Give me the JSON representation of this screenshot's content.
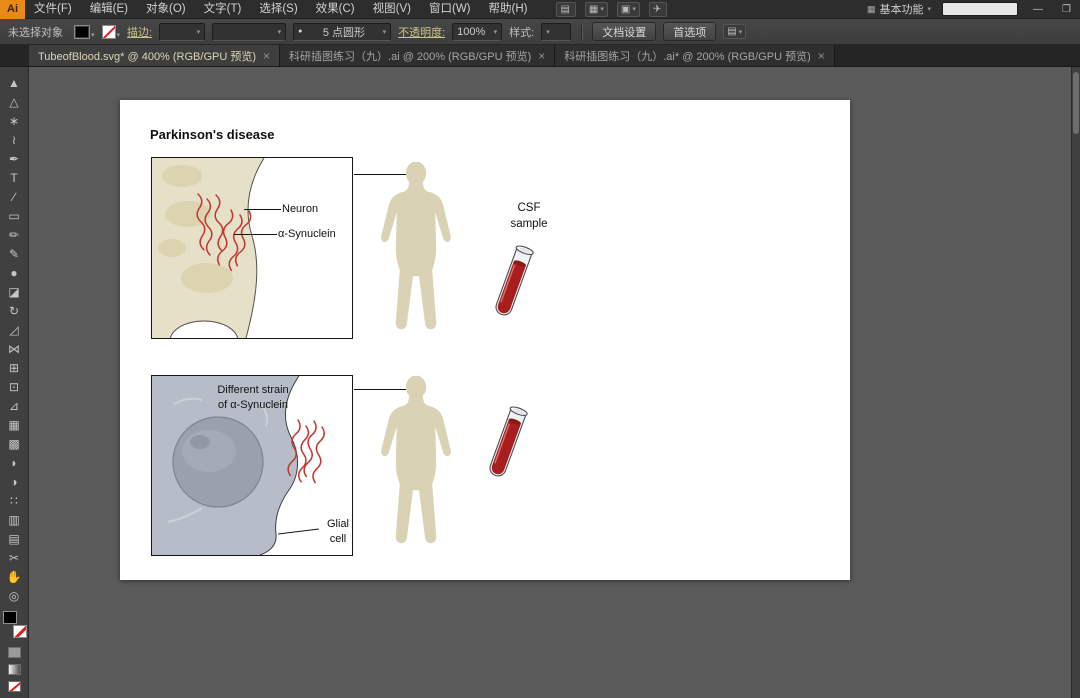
{
  "icons": {
    "caret": "▾",
    "close": "×",
    "brush_dot": "●",
    "panel_menu": "▤",
    "workspace_grid": "▦"
  },
  "colors": {
    "blood_red": "#a81d1d",
    "synuclein_red": "#c0372f",
    "neuron_beige": "#e6e0c8",
    "glial_gray": "#b7bdc8",
    "body_tan": "#d9d2b4"
  },
  "menu_bar": {
    "logo": "Ai",
    "items": [
      "文件(F)",
      "编辑(E)",
      "对象(O)",
      "文字(T)",
      "选择(S)",
      "效果(C)",
      "视图(V)",
      "窗口(W)",
      "帮助(H)"
    ],
    "quick_icons": [
      {
        "name": "bridge-icon",
        "glyph": "▤",
        "caret": ""
      },
      {
        "name": "arrange-documents-icon",
        "glyph": "▦",
        "caret": "▾"
      },
      {
        "name": "document-layout-icon",
        "glyph": "▣",
        "caret": "▾"
      },
      {
        "name": "share-icon",
        "glyph": "✈",
        "caret": ""
      }
    ],
    "workspace_label": "基本功能",
    "search_placeholder": "",
    "minimize_glyph": "—",
    "maximize_glyph": "❐"
  },
  "control_bar": {
    "selection_status": "未选择对象",
    "stroke_link": "描边:",
    "stroke_weight_value": "",
    "width_profile_value": "",
    "brush_value": "5 点圆形",
    "opacity_link": "不透明度:",
    "opacity_value": "100%",
    "style_label": "样式:",
    "doc_setup_button": "文档设置",
    "preferences_button": "首选项"
  },
  "tabs": [
    {
      "label": "TubeofBlood.svg* @ 400% (RGB/GPU 预览)",
      "close": "×",
      "active": true
    },
    {
      "label": "科研插图练习（九）.ai @ 200% (RGB/GPU 预览)",
      "close": "×",
      "active": false
    },
    {
      "label": "科研插图练习（九）.ai* @ 200% (RGB/GPU 预览)",
      "close": "×",
      "active": false
    }
  ],
  "tools": [
    {
      "name": "selection-tool",
      "glyph": "▲"
    },
    {
      "name": "direct-selection-tool",
      "glyph": "△"
    },
    {
      "name": "magic-wand-tool",
      "glyph": "∗"
    },
    {
      "name": "lasso-tool",
      "glyph": "≀"
    },
    {
      "name": "pen-tool",
      "glyph": "✒"
    },
    {
      "name": "type-tool",
      "glyph": "T"
    },
    {
      "name": "line-segment-tool",
      "glyph": "∕"
    },
    {
      "name": "rectangle-tool",
      "glyph": "▭"
    },
    {
      "name": "paintbrush-tool",
      "glyph": "✏"
    },
    {
      "name": "pencil-tool",
      "glyph": "✎"
    },
    {
      "name": "blob-brush-tool",
      "glyph": "●"
    },
    {
      "name": "eraser-tool",
      "glyph": "◪"
    },
    {
      "name": "rotate-tool",
      "glyph": "↻"
    },
    {
      "name": "scale-tool",
      "glyph": "◿"
    },
    {
      "name": "width-tool",
      "glyph": "⋈"
    },
    {
      "name": "free-transform-tool",
      "glyph": "⊞"
    },
    {
      "name": "shape-builder-tool",
      "glyph": "⊡"
    },
    {
      "name": "perspective-grid-tool",
      "glyph": "⊿"
    },
    {
      "name": "mesh-tool",
      "glyph": "▦"
    },
    {
      "name": "gradient-tool",
      "glyph": "▩"
    },
    {
      "name": "eyedropper-tool",
      "glyph": "◗"
    },
    {
      "name": "blend-tool",
      "glyph": "◑"
    },
    {
      "name": "symbol-sprayer-tool",
      "glyph": "∷"
    },
    {
      "name": "column-graph-tool",
      "glyph": "▥"
    },
    {
      "name": "artboard-tool",
      "glyph": "▤"
    },
    {
      "name": "slice-tool",
      "glyph": "✂"
    },
    {
      "name": "hand-tool",
      "glyph": "✋"
    },
    {
      "name": "zoom-tool",
      "glyph": "◎"
    }
  ],
  "artboard": {
    "title": "Parkinson's disease",
    "panel_top": {
      "neuron_label": "Neuron",
      "synuclein_label": "α-Synuclein"
    },
    "csf_label_line1": "CSF",
    "csf_label_line2": "sample",
    "panel_bottom": {
      "strain_label_line1": "Different strain",
      "strain_label_line2": "of α-Synuclein",
      "glial_label_line1": "Glial",
      "glial_label_line2": "cell"
    }
  }
}
